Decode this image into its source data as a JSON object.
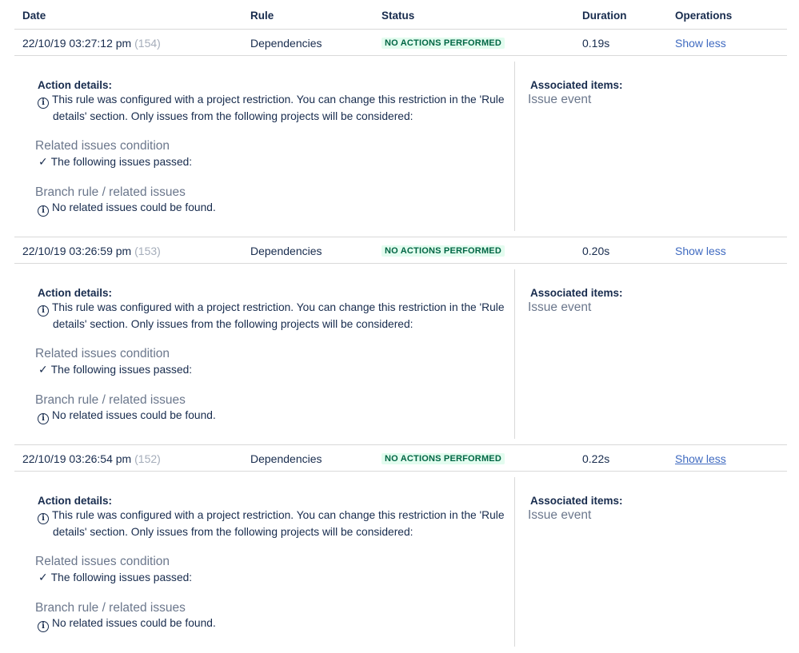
{
  "header": {
    "date": "Date",
    "rule": "Rule",
    "status": "Status",
    "duration": "Duration",
    "operations": "Operations"
  },
  "rows": [
    {
      "date": "22/10/19 03:27:12 pm",
      "id": "(154)",
      "rule": "Dependencies",
      "status": "NO ACTIONS PERFORMED",
      "duration": "0.19s",
      "operation": "Show less",
      "action_details_label": "Action details:",
      "restriction_line1": "This rule was configured with a project restriction. You can change this restriction in the 'Rule",
      "restriction_line2": "details' section. Only issues from the following projects will be considered:",
      "related_condition_heading": "Related issues condition",
      "passed_text": "The following issues passed:",
      "branch_heading": "Branch rule / related issues",
      "no_related_text": "No related issues could be found.",
      "associated_label": "Associated items:",
      "associated_value": "Issue event"
    },
    {
      "date": "22/10/19 03:26:59 pm",
      "id": "(153)",
      "rule": "Dependencies",
      "status": "NO ACTIONS PERFORMED",
      "duration": "0.20s",
      "operation": "Show less",
      "action_details_label": "Action details:",
      "restriction_line1": "This rule was configured with a project restriction. You can change this restriction in the 'Rule",
      "restriction_line2": "details' section. Only issues from the following projects will be considered:",
      "related_condition_heading": "Related issues condition",
      "passed_text": "The following issues passed:",
      "branch_heading": "Branch rule / related issues",
      "no_related_text": "No related issues could be found.",
      "associated_label": "Associated items:",
      "associated_value": "Issue event"
    },
    {
      "date": "22/10/19 03:26:54 pm",
      "id": "(152)",
      "rule": "Dependencies",
      "status": "NO ACTIONS PERFORMED",
      "duration": "0.22s",
      "operation": "Show less",
      "action_details_label": "Action details:",
      "restriction_line1": "This rule was configured with a project restriction. You can change this restriction in the 'Rule",
      "restriction_line2": "details' section. Only issues from the following projects will be considered:",
      "related_condition_heading": "Related issues condition",
      "passed_text": "The following issues passed:",
      "branch_heading": "Branch rule / related issues",
      "no_related_text": "No related issues could be found.",
      "associated_label": "Associated items:",
      "associated_value": "Issue event"
    }
  ],
  "icons": {
    "info": "info-icon",
    "check": "check-icon"
  },
  "colors": {
    "status_bg": "#e3fcef",
    "status_text": "#006644",
    "link": "#3f6ac0",
    "muted": "#6b778c"
  }
}
